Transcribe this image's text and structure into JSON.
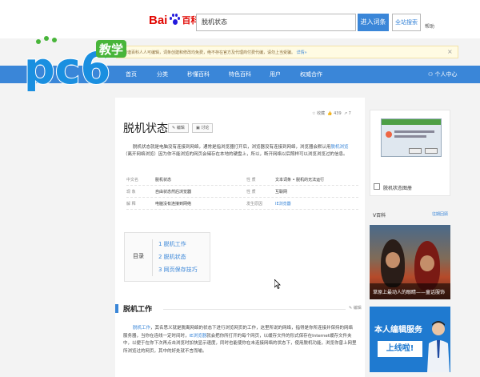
{
  "header": {
    "brand_bai": "Bai",
    "brand_baike": "百科",
    "search_value": "脱机状态",
    "enter_button": "进入词条",
    "search_button": "全站搜索",
    "help_link": "帮助"
  },
  "notice": {
    "text": "和谐百科人人可编辑，词条创建和修改均免费，绝不存在官方及代理商付费代编，请勿上当受骗。",
    "link": "详情»"
  },
  "watermark": {
    "pc6": "pc6",
    "jiaoxue": "教学"
  },
  "nav": {
    "items": [
      "首页",
      "分类",
      "秒懂百科",
      "特色百科",
      "用户",
      "权威合作"
    ],
    "user_center": "个人中心"
  },
  "article": {
    "title": "脱机状态",
    "edit_button": "编辑",
    "discuss_button": "讨论",
    "tools": [
      "收藏",
      "439",
      "7"
    ],
    "intro_part1": "脱机状态就是电脑没有连接到网络，通常是指浏览器打开后，浏览器没有连接到网络，浏览器会默认用",
    "intro_link": "脱机浏览",
    "intro_part2": "（离开网络浏览）因为你不能浏览的网页会储存在本地的硬盘上，所以，断开网络以后照样可以浏览浏览过的信息。",
    "info_rows": [
      {
        "k1": "中文名",
        "v1": "脱机状态",
        "k2": "性    质",
        "v2": "文本词条 • 脱机的无法运行",
        "link2": false
      },
      {
        "k1": "现    象",
        "v1": "自由状态然后浏览器",
        "k2": "性    质",
        "v2": "互联网",
        "link2": false
      },
      {
        "k1": "解    释",
        "v1": "电脑没有连接到网络",
        "k2": "发生原因",
        "v2": "IE浏览器",
        "link2": true
      }
    ],
    "toc_label": "目录",
    "toc_items": [
      "1 脱机工作",
      "2 脱机状态",
      "3 网页保存技巧"
    ],
    "section_title": "脱机工作",
    "section_edit": "编辑",
    "section_link1": "脱机工作",
    "section_part1": "，其名思义就是脱离网络的状态下进行浏览网页的工作，这里所说的网络，指得是你所连接并保持的网络服务器，当你在连线一定时间时，",
    "section_link2": "IE浏览器",
    "section_part2": "就会把你所打开的每个网页，以缓存文件的形式保存在Internet缓存文件夹中，以便于在你下次再点击浏览时加快显示速度，同时也能使你在未连接网络的状态下，使用脱机功能，浏览你曾上网里所浏览过的网页，其中的好处就不言而喻。"
  },
  "sidebar": {
    "card_caption": "脱机状态图册",
    "video_head": "V百科",
    "video_more": "往期回顾",
    "video_caption": "草原上最动人的眼睛——童话服饰",
    "ad_line1": "本人编辑服务",
    "ad_line2": "上线啦!"
  },
  "colors": {
    "accent": "#3a86d8",
    "baidu_red": "#e10601",
    "pc6_blue": "#1a8fe0",
    "pc6_green": "#48b53a"
  }
}
